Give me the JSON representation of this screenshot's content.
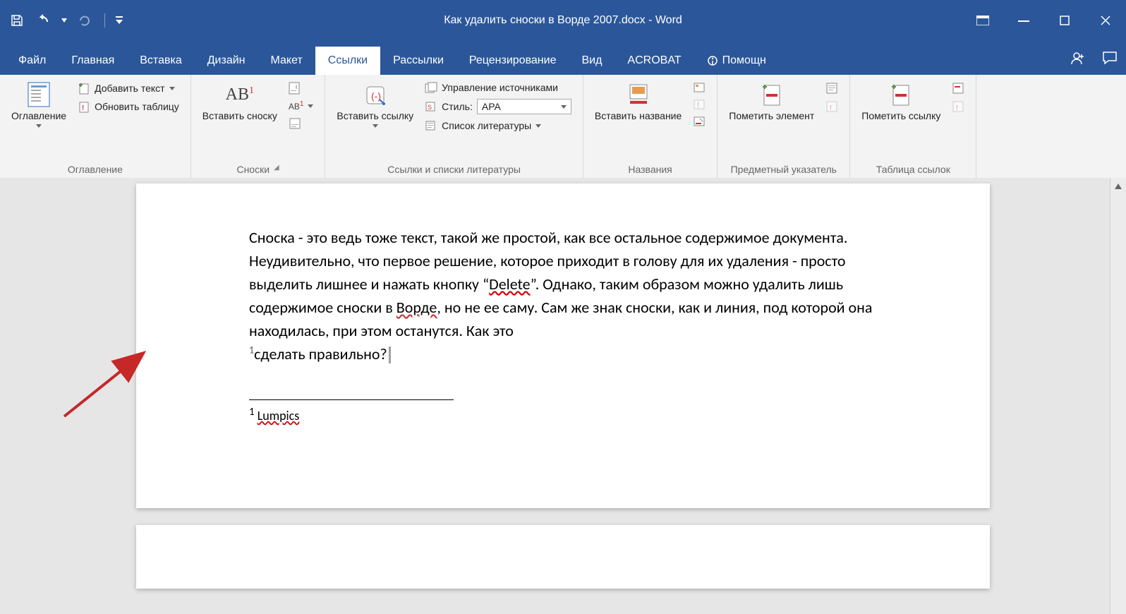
{
  "titlebar": {
    "title": "Как удалить сноски в Ворде 2007.docx - Word"
  },
  "tabs": {
    "file": "Файл",
    "home": "Главная",
    "insert": "Вставка",
    "design": "Дизайн",
    "layout": "Макет",
    "references": "Ссылки",
    "mailings": "Рассылки",
    "review": "Рецензирование",
    "view": "Вид",
    "acrobat": "ACROBAT",
    "tellme": "Помощн"
  },
  "ribbon": {
    "toc": {
      "button": "Оглавление",
      "add_text": "Добавить текст",
      "update": "Обновить таблицу",
      "label": "Оглавление"
    },
    "footnotes": {
      "insert": "Вставить сноску",
      "label": "Сноски"
    },
    "citations": {
      "insert": "Вставить ссылку",
      "manage": "Управление источниками",
      "style_label": "Стиль:",
      "style_value": "APA",
      "biblio": "Список литературы",
      "label": "Ссылки и списки литературы"
    },
    "captions": {
      "insert": "Вставить название",
      "label": "Названия"
    },
    "index": {
      "mark": "Пометить элемент",
      "label": "Предметный указатель"
    },
    "toa": {
      "mark": "Пометить ссылку",
      "label": "Таблица ссылок"
    }
  },
  "document": {
    "paragraph": "Сноска - это ведь тоже текст, такой же простой, как все остальное содержимое документа. Неудивительно, что первое решение, которое приходит в голову для их удаления - просто выделить лишнее и нажать кнопку “",
    "delete_word": "Delete",
    "para_after_delete": "”. Однако, таким образом можно удалить лишь содержимое сноски в ",
    "word_word": "Ворде",
    "para_after_word": ", но не ее саму. Сам же знак сноски, как и линия, под которой она находилась, при этом останутся. Как это ",
    "fn_mark": "1",
    "para_last": "сделать правильно?",
    "footnote_num": "1",
    "footnote_text": "Lumpics"
  }
}
